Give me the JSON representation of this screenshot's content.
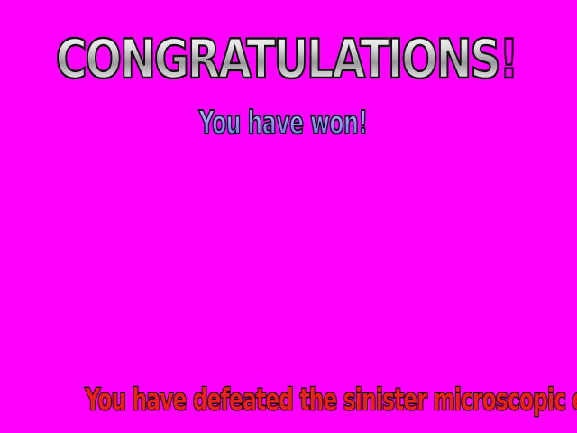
{
  "screen": {
    "background_color": "#ff00ff",
    "headline": "CONGRATULATIONS!",
    "subheadline": "You have won!",
    "message": "You have defeated the sinister microscopic evil"
  },
  "colors": {
    "headline_fill": "#d8d8d8",
    "subheadline_fill": "#9aa2ff",
    "message_fill": "#e8201e",
    "outline": "#000000"
  }
}
